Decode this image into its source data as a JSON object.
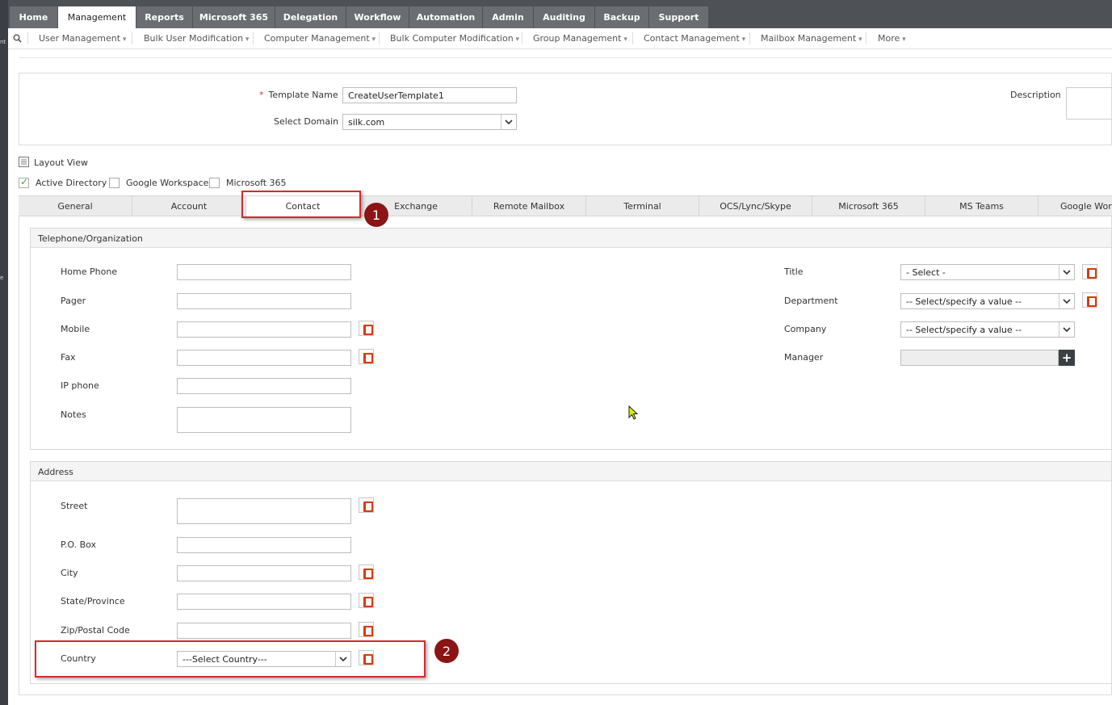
{
  "top_tabs": [
    "Home",
    "Management",
    "Reports",
    "Microsoft 365",
    "Delegation",
    "Workflow",
    "Automation",
    "Admin",
    "Auditing",
    "Backup",
    "Support"
  ],
  "sub_menu": [
    "User Management",
    "Bulk User Modification",
    "Computer Management",
    "Bulk Computer Modification",
    "Group Management",
    "Contact Management",
    "Mailbox Management",
    "More"
  ],
  "left_strip": [
    "nt",
    "e"
  ],
  "template": {
    "name_label": "Template Name",
    "name_value": "CreateUserTemplate1",
    "domain_label": "Select Domain",
    "domain_value": "silk.com",
    "description_label": "Description",
    "required_mark": "*"
  },
  "layout_view": "Layout View",
  "checkboxes": [
    {
      "label": "Active Directory",
      "checked": true
    },
    {
      "label": "Google Workspace",
      "checked": false
    },
    {
      "label": "Microsoft 365",
      "checked": false
    }
  ],
  "content_tabs": [
    "General",
    "Account",
    "Contact",
    "Exchange",
    "Remote Mailbox",
    "Terminal",
    "OCS/Lync/Skype",
    "Microsoft 365",
    "MS Teams",
    "Google Work"
  ],
  "active_content_tab": "Contact",
  "telephone": {
    "title": "Telephone/Organization",
    "home_phone": "Home Phone",
    "pager": "Pager",
    "mobile": "Mobile",
    "fax": "Fax",
    "ip_phone": "IP phone",
    "notes": "Notes",
    "title_label": "Title",
    "title_value": "- Select -",
    "department_label": "Department",
    "department_value": "-- Select/specify a value --",
    "company_label": "Company",
    "company_value": "-- Select/specify a value --",
    "manager_label": "Manager",
    "manager_button": "+"
  },
  "address": {
    "title": "Address",
    "street": "Street",
    "po_box": "P.O. Box",
    "city": "City",
    "state": "State/Province",
    "zip": "Zip/Postal Code",
    "country": "Country",
    "country_value": "---Select Country---"
  },
  "annotations": [
    "1",
    "2"
  ],
  "colors": {
    "topbar": "#4e5256",
    "tab": "#6a6e72",
    "highlight": "#d9292b",
    "badge": "#8b1414",
    "office": "#d83b01"
  }
}
